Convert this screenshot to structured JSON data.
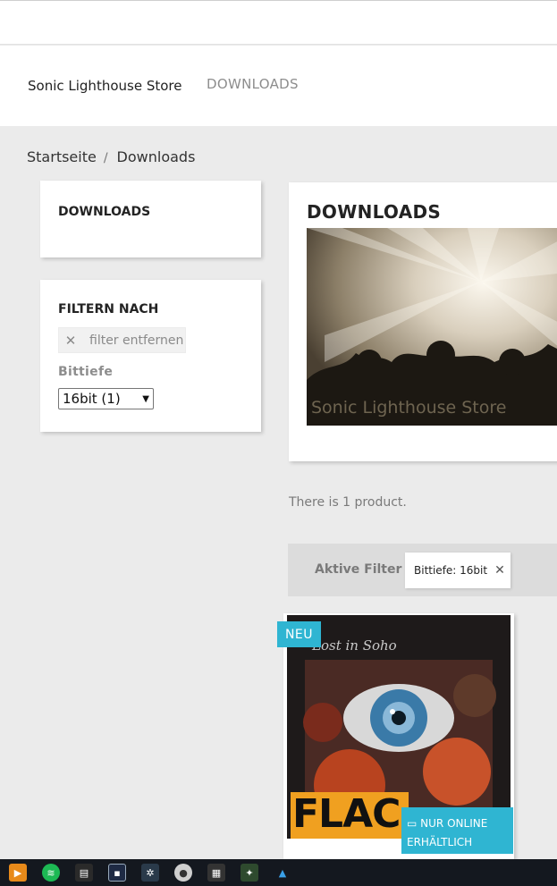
{
  "header": {
    "brand": "Sonic Lighthouse Store",
    "nav_downloads": "DOWNLOADS"
  },
  "breadcrumb": {
    "home": "Startseite",
    "separator": "/",
    "current": "Downloads"
  },
  "sidebar": {
    "category_title": "DOWNLOADS",
    "filter_title": "FILTERN NACH",
    "clear_filters_label": "filter entfernen",
    "facet_title": "Bittiefe",
    "facet_selected": "16bit (1)"
  },
  "main": {
    "title": "DOWNLOADS",
    "banner_text": "Sonic Lighthouse Store",
    "product_count": "There is 1 product."
  },
  "active_filters": {
    "label": "Aktive Filter",
    "chip": "Bittiefe: 16bit"
  },
  "product": {
    "badge_new": "NEU",
    "cover_title": "Lost in Soho",
    "format_label": "FLAC",
    "online_badge_line1": "NUR ONLINE",
    "online_badge_line2": "ERHÄLTLICH"
  },
  "colors": {
    "accent": "#2fb5d2",
    "page_bg": "#ebebeb",
    "flac_orange": "#f0a020"
  },
  "taskbar": {
    "icons": [
      "media-player-icon",
      "spotify-icon",
      "video-editor-icon",
      "terminal-icon",
      "settings-icon",
      "pig-icon",
      "app-icon",
      "android-icon",
      "vlc-icon"
    ]
  }
}
